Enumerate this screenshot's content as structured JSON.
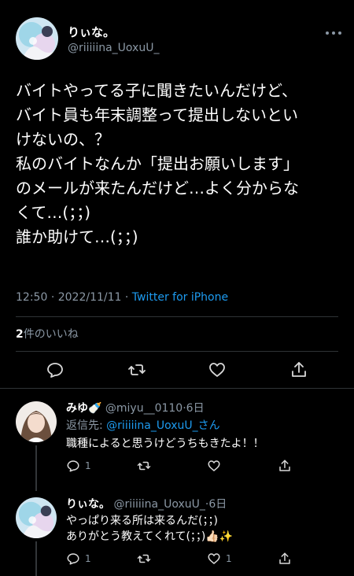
{
  "main_tweet": {
    "author_name": "りぃな。",
    "author_handle": "@riiiiina_UoxuU_",
    "lines": [
      "バイトやってる子に聞きたいんだけど、",
      "バイト員も年末調整って提出しないとい",
      "けないの、？",
      "私のバイトなんか「提出お願いします」",
      "のメールが来たんだけど…よく分からな",
      "くて…(；；)",
      "誰か助けて…(；；)"
    ],
    "time": "12:50",
    "date": "2022/11/11",
    "separator": "·",
    "source": "Twitter for iPhone",
    "likes_count": "2",
    "likes_label": "件のいいね"
  },
  "replies": [
    {
      "name": "みゆ🍼",
      "handle": "@miyu__0110",
      "age": "6日",
      "replying_prefix": "返信先: ",
      "replying_handle": "@riiiiina_UoxuU_さん",
      "lines": [
        "職種によると思うけどうちもきたよ！！"
      ],
      "reply_count": "1",
      "like_count": ""
    },
    {
      "name": "りぃな。",
      "handle": "@riiiiina_UoxuU_",
      "age": "6日",
      "lines": [
        "やっぱり来る所は来るんだ(；；)",
        "ありがとう教えてくれて(；；)👍🏻✨"
      ],
      "reply_count": "1",
      "like_count": "1"
    }
  ],
  "colors": {
    "background": "#000000",
    "text": "#e7e9ea",
    "secondary": "#8b98a5",
    "accent": "#1d9bf0",
    "divider": "#2f3336"
  }
}
